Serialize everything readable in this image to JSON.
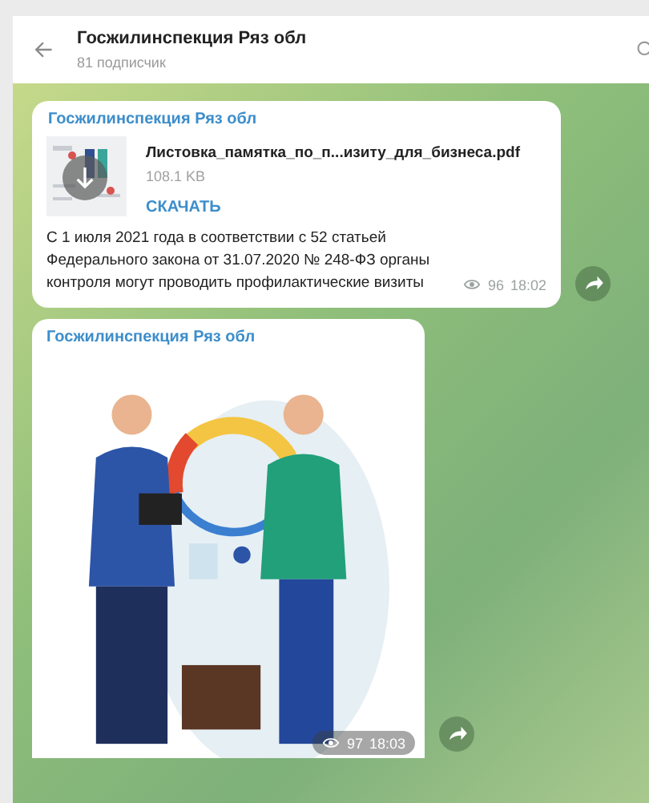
{
  "header": {
    "title": "Госжилинспекция Ряз обл",
    "subtitle": "81 подписчик"
  },
  "messages": [
    {
      "kind": "file",
      "author": "Госжилинспекция Ряз обл",
      "file": {
        "name": "Листовка_памятка_по_п...изиту_для_бизнеса.pdf",
        "size": "108.1 KB",
        "action": "СКАЧАТЬ"
      },
      "text": "С 1 июля 2021 года в соответствии с 52 статьей Федерального закона от 31.07.2020 № 248-ФЗ органы контроля могут проводить профилактические визиты",
      "views": "96",
      "time": "18:02"
    },
    {
      "author": "Госжилинспекция Ряз обл",
      "views": "97",
      "time": "18:03"
    }
  ]
}
